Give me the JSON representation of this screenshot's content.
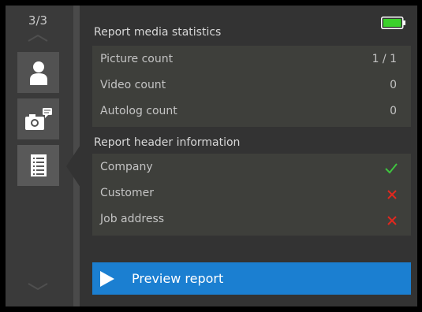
{
  "sidebar": {
    "page_indicator": "3/3",
    "tabs": [
      {
        "icon": "person-icon"
      },
      {
        "icon": "camera-comment-icon"
      },
      {
        "icon": "document-list-icon",
        "active": true
      }
    ]
  },
  "status": {
    "battery_icon": "battery-full-icon",
    "battery_color": "#3bd12b"
  },
  "media": {
    "title": "Report media statistics",
    "rows": [
      {
        "label": "Picture count",
        "value": "1 / 1"
      },
      {
        "label": "Video count",
        "value": "0"
      },
      {
        "label": "Autolog count",
        "value": "0"
      }
    ]
  },
  "header_info": {
    "title": "Report header information",
    "rows": [
      {
        "label": "Company",
        "status": "check",
        "status_color": "#3fc43f"
      },
      {
        "label": "Customer",
        "status": "cross",
        "status_color": "#e0281e"
      },
      {
        "label": "Job address",
        "status": "cross",
        "status_color": "#e0281e"
      }
    ]
  },
  "preview_button": {
    "label": "Preview report",
    "color": "#1b7fd1"
  }
}
